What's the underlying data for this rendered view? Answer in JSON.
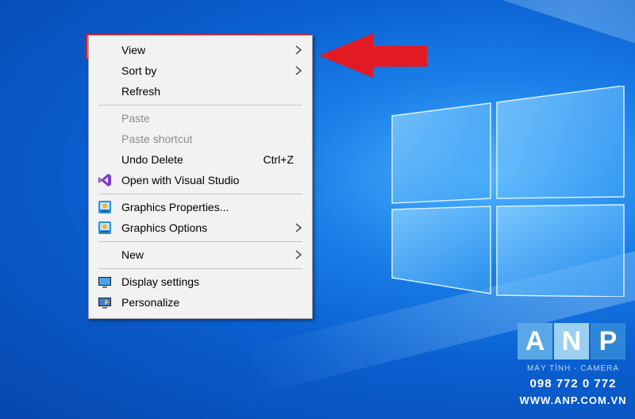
{
  "menu": {
    "items": [
      {
        "label": "View",
        "submenu": true,
        "disabled": false
      },
      {
        "label": "Sort by",
        "submenu": true,
        "disabled": false
      },
      {
        "label": "Refresh",
        "submenu": false,
        "disabled": false
      },
      {
        "label": "Paste",
        "submenu": false,
        "disabled": true
      },
      {
        "label": "Paste shortcut",
        "submenu": false,
        "disabled": true
      },
      {
        "label": "Undo Delete",
        "shortcut": "Ctrl+Z",
        "submenu": false,
        "disabled": false
      },
      {
        "label": "Open with Visual Studio",
        "icon": "visual-studio-icon",
        "submenu": false,
        "disabled": false
      },
      {
        "label": "Graphics Properties...",
        "icon": "intel-graphics-icon",
        "submenu": false,
        "disabled": false
      },
      {
        "label": "Graphics Options",
        "icon": "intel-graphics-icon",
        "submenu": true,
        "disabled": false
      },
      {
        "label": "New",
        "submenu": true,
        "disabled": false
      },
      {
        "label": "Display settings",
        "icon": "display-icon",
        "submenu": false,
        "disabled": false
      },
      {
        "label": "Personalize",
        "icon": "personalize-icon",
        "submenu": false,
        "disabled": false
      }
    ]
  },
  "watermark": {
    "letters": [
      "A",
      "N",
      "P"
    ],
    "tagline": "MÁY TÍNH - CAMERA",
    "phone": "098 772 0 772",
    "website": "WWW.ANP.COM.VN"
  },
  "colors": {
    "highlight_border": "#e21a23",
    "arrow": "#e21a23",
    "wm_a": "#5aa7e6",
    "wm_n": "#9bd0f2",
    "wm_p": "#2f86d8"
  }
}
